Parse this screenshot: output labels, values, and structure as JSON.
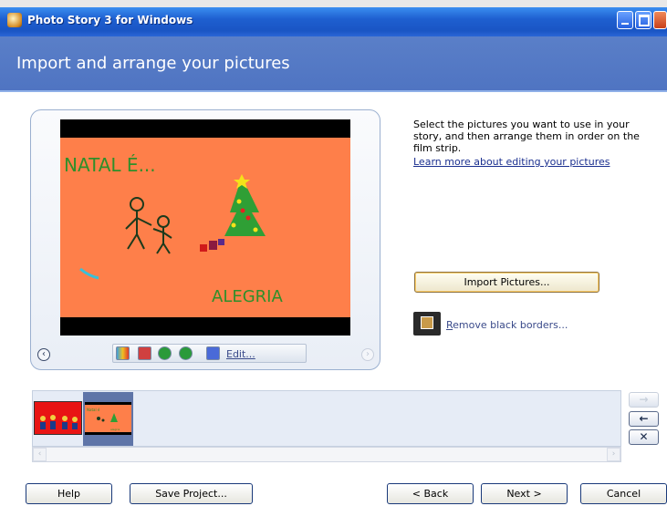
{
  "window": {
    "title": "Photo Story 3 for Windows"
  },
  "header": {
    "title": "Import and arrange your pictures"
  },
  "picture": {
    "text_top": "NATAL É...",
    "text_bottom": "ALEGRIA",
    "colors": {
      "background": "#fe7f4a",
      "letterbox": "#000000"
    }
  },
  "preview_toolbar": {
    "tools": [
      "color-correction-icon",
      "red-eye-icon",
      "rotate-left-icon",
      "rotate-right-icon",
      "edit-icon"
    ],
    "edit_label": "Edit..."
  },
  "instructions": {
    "text": "Select the pictures you want to use in your story, and then arrange them in order on the film strip.",
    "learn_link": "Learn more about editing your pictures"
  },
  "actions": {
    "import_button": "Import Pictures...",
    "remove_borders_mnemonic": "R",
    "remove_borders_rest": "emove black borders..."
  },
  "filmstrip": {
    "thumbnails": [
      {
        "label": "picture-1",
        "selected": false
      },
      {
        "label": "picture-2",
        "selected": true
      }
    ],
    "thumb2_text_top": "Natal é",
    "thumb2_text_bottom": "alegria"
  },
  "side_buttons": {
    "move_right": "→",
    "move_left": "←",
    "delete": "✕"
  },
  "footer": {
    "help": "Help",
    "save_project": "Save Project...",
    "back": "< Back",
    "next": "Next >",
    "cancel": "Cancel"
  },
  "theme": {
    "titlebar": "#1e5fd0",
    "header_band": "#4f74c2",
    "link": "#1a2f8f"
  }
}
